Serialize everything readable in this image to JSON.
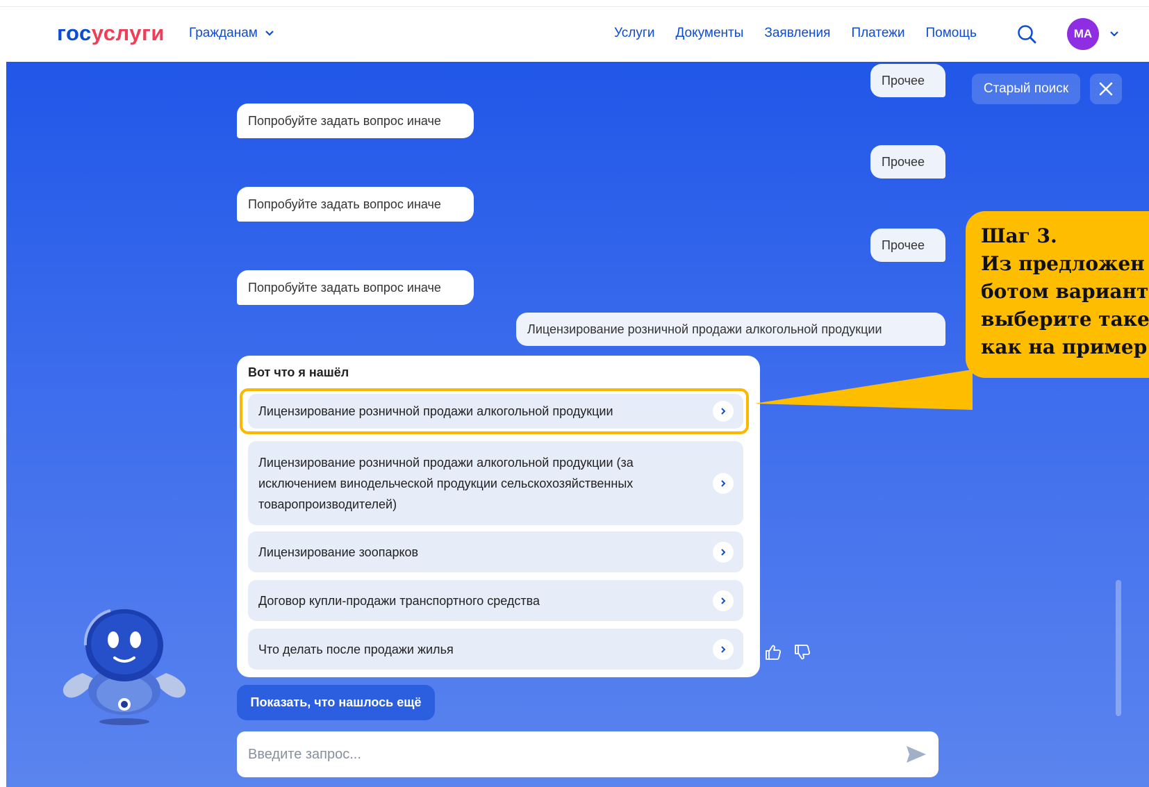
{
  "header": {
    "logo_part1": "гос",
    "logo_part2": "услуги",
    "audience_label": "Гражданам",
    "nav": [
      "Услуги",
      "Документы",
      "Заявления",
      "Платежи",
      "Помощь"
    ],
    "avatar_initials": "МА"
  },
  "chat": {
    "old_search_label": "Старый поиск",
    "messages": [
      {
        "role": "user",
        "text": "Прочее"
      },
      {
        "role": "bot",
        "text": "Попробуйте задать вопрос иначе"
      },
      {
        "role": "user",
        "text": "Прочее"
      },
      {
        "role": "bot",
        "text": "Попробуйте задать вопрос иначе"
      },
      {
        "role": "user",
        "text": "Прочее"
      },
      {
        "role": "bot",
        "text": "Попробуйте задать вопрос иначе"
      },
      {
        "role": "user",
        "text": "Лицензирование розничной продажи алкогольной продукции"
      }
    ],
    "results": {
      "title": "Вот что я нашёл",
      "items": [
        "Лицензирование розничной продажи алкогольной продукции",
        "Лицензирование розничной продажи алкогольной продукции (за исключением винодельческой продукции сельскохозяйственных товаропроизводителей)",
        "Лицензирование зоопарков",
        "Договор купли-продажи транспортного средства",
        "Что делать после продажи жилья"
      ],
      "highlighted_index": 0
    },
    "show_more_label": "Показать, что нашлось ещё",
    "input_placeholder": "Введите запрос..."
  },
  "callout": {
    "lines": [
      "Шаг 3.",
      "Из предложен",
      "ботом вариант",
      "выберите таке",
      "как на пример"
    ]
  },
  "colors": {
    "brand_blue": "#0d4cd3",
    "brand_red": "#ee3f58",
    "highlight": "#fbb800",
    "avatar": "#8e2de2"
  },
  "icons": {
    "search": "search-icon",
    "close": "close-icon",
    "send": "send-icon",
    "like": "thumbs-up-icon",
    "dislike": "thumbs-down-icon",
    "chevron": "chevron-right-icon"
  }
}
